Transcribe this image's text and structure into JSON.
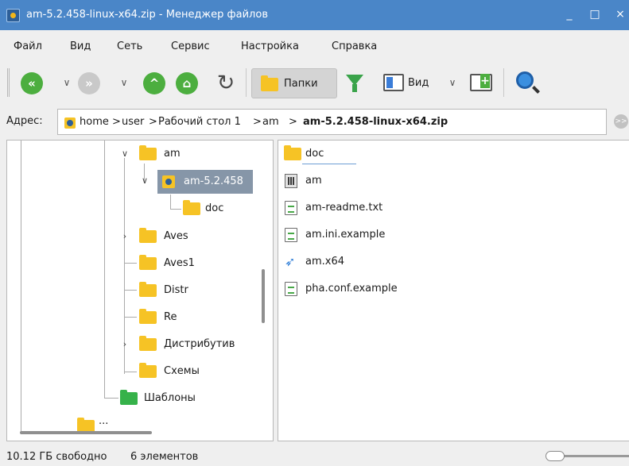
{
  "window": {
    "title": "am-5.2.458-linux-x64.zip - Менеджер файлов",
    "minimize": "_",
    "maximize": "□",
    "close": "×"
  },
  "menu": [
    "Файл",
    "Вид",
    "Сеть",
    "Сервис",
    "Настройка",
    "Справка"
  ],
  "toolbar": {
    "back_icon": "«",
    "forward_icon": "»",
    "dropdown_glyph": "∨",
    "up_icon": "^",
    "home_icon": "⌂",
    "reload_icon": "↻",
    "folders_label": "Папки",
    "view_label": "Вид",
    "folders_active": true
  },
  "address": {
    "label": "Адрес:",
    "crumbs": [
      "home",
      "user",
      "Рабочий стол 1",
      "am",
      "am-5.2.458-linux-x64.zip"
    ],
    "separator": ">",
    "go_glyph": ">>"
  },
  "tree": {
    "nodes": [
      {
        "label": "am",
        "expanded": true
      },
      {
        "label": "am-5.2.458",
        "expanded": true,
        "selected": true
      },
      {
        "label": "doc"
      },
      {
        "label": "Aves",
        "has_children": true
      },
      {
        "label": "Aves1"
      },
      {
        "label": "Distr"
      },
      {
        "label": "Re"
      },
      {
        "label": "Дистрибутив",
        "has_children": true
      },
      {
        "label": "Схемы"
      },
      {
        "label": "Шаблоны"
      },
      {
        "label": "..."
      }
    ]
  },
  "files": {
    "items": [
      {
        "name": "doc",
        "icon": "folder-icon"
      },
      {
        "name": "am",
        "icon": "binary-file-icon"
      },
      {
        "name": "am-readme.txt",
        "icon": "text-file-icon"
      },
      {
        "name": "am.ini.example",
        "icon": "text-file-icon"
      },
      {
        "name": "am.x64",
        "icon": "rocket-icon"
      },
      {
        "name": "pha.conf.example",
        "icon": "text-file-icon"
      }
    ]
  },
  "status": {
    "free_space": "10.12 ГБ свободно",
    "item_count": "6 элементов"
  },
  "colors": {
    "titlebar": "#4a86c8",
    "folder": "#f6c325",
    "green_folder": "#36b24a",
    "accent_green": "#4cae3f",
    "selection": "#8696a8"
  }
}
